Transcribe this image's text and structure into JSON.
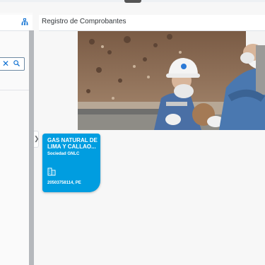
{
  "right_panel": {
    "title": "Registro de Comprobantes"
  },
  "tile": {
    "title": "GAS NATURAL DE LIMA Y CALLAO...",
    "subtitle": "Sociedad GNLC",
    "id_text": "20503758114, PE",
    "icon": "building-icon",
    "color": "#009de0"
  },
  "left_panel": {
    "header_icon": "hierarchy-icon",
    "search": {
      "value": "",
      "clear_icon": "close-icon",
      "search_icon": "search-icon"
    }
  },
  "splitter": {
    "icon": "chevron-right-icon"
  },
  "hero": {
    "description_visible": "worker-photo"
  }
}
